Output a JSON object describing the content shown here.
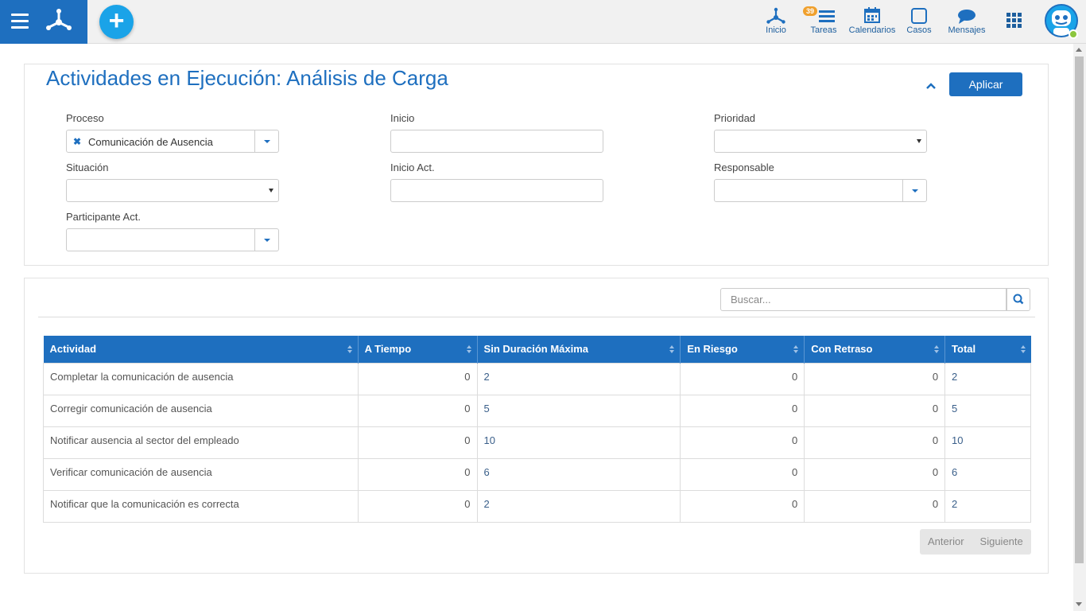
{
  "topbar": {
    "add_label": "+",
    "nav": [
      {
        "label": "Inicio",
        "icon": "flow-logo-icon"
      },
      {
        "label": "Tareas",
        "icon": "tasks-icon",
        "badge": "39"
      },
      {
        "label": "Calendarios",
        "icon": "calendar-icon"
      },
      {
        "label": "Casos",
        "icon": "cases-icon"
      },
      {
        "label": "Mensajes",
        "icon": "messages-icon"
      }
    ]
  },
  "filters": {
    "title": "Actividades en Ejecución: Análisis de Carga",
    "apply_label": "Aplicar",
    "proceso": {
      "label": "Proceso",
      "value": "Comunicación de Ausencia"
    },
    "inicio": {
      "label": "Inicio",
      "value": ""
    },
    "prioridad": {
      "label": "Prioridad",
      "value": ""
    },
    "situacion": {
      "label": "Situación",
      "value": ""
    },
    "inicio_act": {
      "label": "Inicio Act.",
      "value": ""
    },
    "responsable": {
      "label": "Responsable",
      "value": ""
    },
    "participante_act": {
      "label": "Participante Act.",
      "value": ""
    }
  },
  "search": {
    "placeholder": "Buscar...",
    "value": ""
  },
  "table": {
    "columns": [
      "Actividad",
      "A Tiempo",
      "Sin Duración Máxima",
      "En Riesgo",
      "Con Retraso",
      "Total"
    ],
    "rows": [
      [
        "Completar la comunicación de ausencia",
        "0",
        "2",
        "0",
        "0",
        "2"
      ],
      [
        "Corregir comunicación de ausencia",
        "0",
        "5",
        "0",
        "0",
        "5"
      ],
      [
        "Notificar ausencia al sector del empleado",
        "0",
        "10",
        "0",
        "0",
        "10"
      ],
      [
        "Verificar comunicación de ausencia",
        "0",
        "6",
        "0",
        "0",
        "6"
      ],
      [
        "Notificar que la comunicación es correcta",
        "0",
        "2",
        "0",
        "0",
        "2"
      ]
    ]
  },
  "pager": {
    "prev_label": "Anterior",
    "next_label": "Siguiente"
  },
  "colors": {
    "primary": "#1e6fbf",
    "accent": "#1aa3e8",
    "badge": "#f0a02d",
    "online": "#8cc63e"
  }
}
